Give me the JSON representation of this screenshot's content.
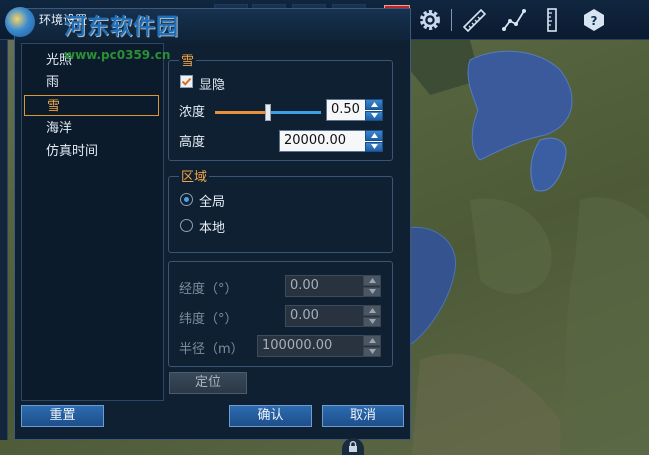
{
  "window": {
    "title": "环境设置"
  },
  "watermark": {
    "site": "河东软件园",
    "url": "www.pc0359.cn"
  },
  "toolbar": {
    "icons": [
      "gear-icon",
      "ruler-diagonal-icon",
      "path-measure-icon",
      "ruler-vertical-icon",
      "help-icon"
    ]
  },
  "nav": {
    "items": [
      {
        "label": "光照"
      },
      {
        "label": "雨"
      },
      {
        "label": "雪",
        "active": true
      },
      {
        "label": "海洋"
      },
      {
        "label": "仿真时间"
      }
    ]
  },
  "snow": {
    "legend": "雪",
    "visible_label": "显隐",
    "visible_checked": true,
    "density_label": "浓度",
    "density_value": "0.50",
    "density_fraction": 0.5,
    "height_label": "高度",
    "height_value": "20000.00"
  },
  "region": {
    "legend": "区域",
    "options": [
      {
        "label": "全局",
        "selected": true
      },
      {
        "label": "本地",
        "selected": false
      }
    ]
  },
  "local": {
    "longitude_label": "经度（°）",
    "longitude_value": "0.00",
    "latitude_label": "纬度（°）",
    "latitude_value": "0.00",
    "radius_label": "半径（m）",
    "radius_value": "100000.00",
    "locate_label": "定位"
  },
  "footer": {
    "reset_label": "重置",
    "ok_label": "确认",
    "cancel_label": "取消"
  },
  "colors": {
    "accent": "#f0a646",
    "button": "#2d6bb0",
    "close": "#c0252b"
  }
}
